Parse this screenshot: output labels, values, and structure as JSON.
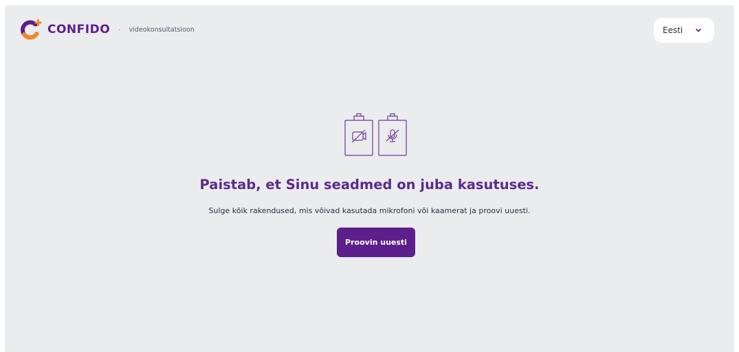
{
  "header": {
    "logo_text": "CONFIDO",
    "separator": "·",
    "subtitle": "videokonsultatsioon",
    "language_selector": {
      "selected": "Eesti",
      "icon": "chevron-down-icon"
    }
  },
  "main": {
    "illustration": {
      "icons": [
        "camera-off-icon",
        "microphone-off-icon"
      ]
    },
    "title": "Paistab, et Sinu seadmed on juba kasutuses.",
    "description": "Sulge kõik rakendused, mis võivad kasutada mikrofoni või kaamerat ja proovi uuesti.",
    "retry_button_label": "Proovin uuesti"
  },
  "colors": {
    "brand_purple": "#5c1f8c",
    "title_purple": "#5b2a8e",
    "brand_orange": "#f08a2a",
    "background": "#ebeced"
  }
}
